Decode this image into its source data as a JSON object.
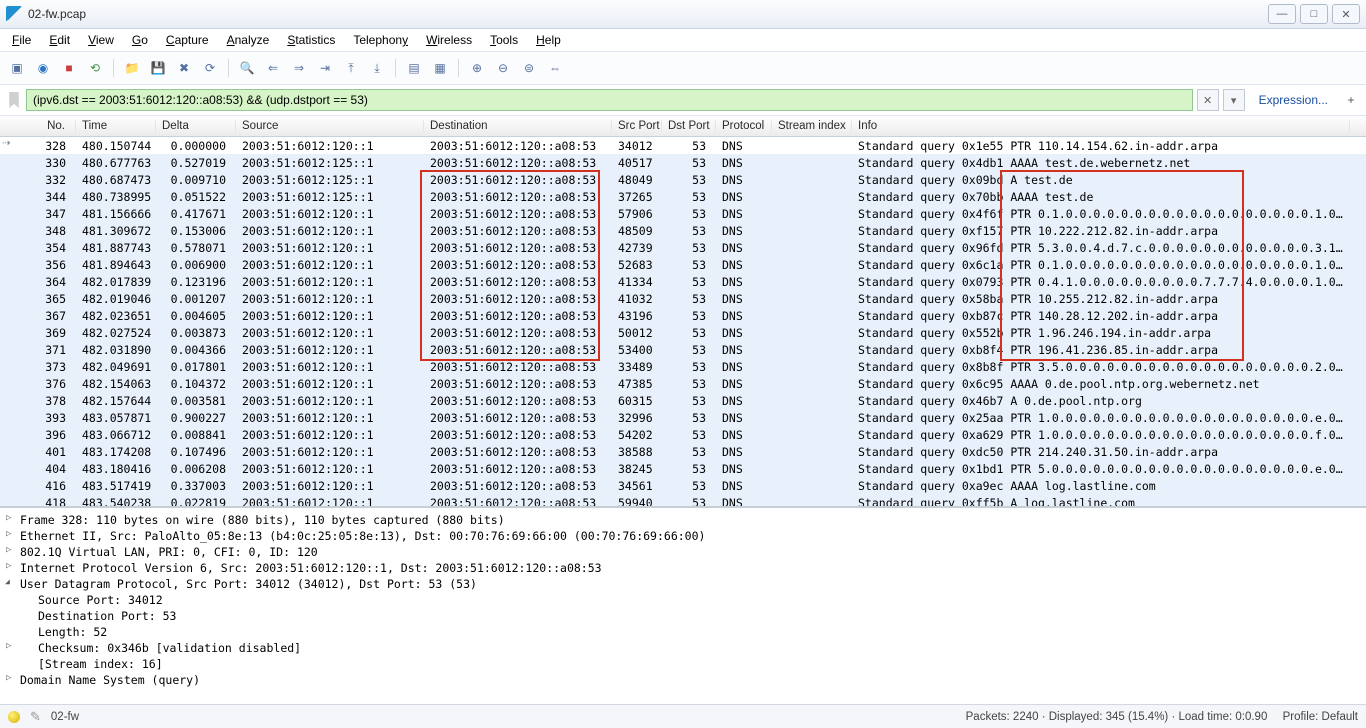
{
  "window": {
    "title": "02-fw.pcap"
  },
  "menu": [
    "File",
    "Edit",
    "View",
    "Go",
    "Capture",
    "Analyze",
    "Statistics",
    "Telephony",
    "Wireless",
    "Tools",
    "Help"
  ],
  "filter": {
    "value": "(ipv6.dst == 2003:51:6012:120::a08:53) && (udp.dstport == 53)",
    "expression_label": "Expression..."
  },
  "columns": {
    "no": "No.",
    "time": "Time",
    "delta": "Delta",
    "source": "Source",
    "destination": "Destination",
    "srcport": "Src Port",
    "dstport": "Dst Port",
    "protocol": "Protocol",
    "stream": "Stream index",
    "info": "Info"
  },
  "rows": [
    {
      "no": "328",
      "time": "480.150744",
      "delta": "0.000000",
      "src": "2003:51:6012:120::1",
      "dst": "2003:51:6012:120::a08:53",
      "sp": "34012",
      "dp": "53",
      "proto": "DNS",
      "info": "Standard query 0x1e55 PTR 110.14.154.62.in-addr.arpa",
      "sel": true
    },
    {
      "no": "330",
      "time": "480.677763",
      "delta": "0.527019",
      "src": "2003:51:6012:125::1",
      "dst": "2003:51:6012:120::a08:53",
      "sp": "40517",
      "dp": "53",
      "proto": "DNS",
      "info": "Standard query 0x4db1 AAAA test.de.webernetz.net"
    },
    {
      "no": "332",
      "time": "480.687473",
      "delta": "0.009710",
      "src": "2003:51:6012:125::1",
      "dst": "2003:51:6012:120::a08:53",
      "sp": "48049",
      "dp": "53",
      "proto": "DNS",
      "info": "Standard query 0x09bd A test.de"
    },
    {
      "no": "344",
      "time": "480.738995",
      "delta": "0.051522",
      "src": "2003:51:6012:125::1",
      "dst": "2003:51:6012:120::a08:53",
      "sp": "37265",
      "dp": "53",
      "proto": "DNS",
      "info": "Standard query 0x70bb AAAA test.de"
    },
    {
      "no": "347",
      "time": "481.156666",
      "delta": "0.417671",
      "src": "2003:51:6012:120::1",
      "dst": "2003:51:6012:120::a08:53",
      "sp": "57906",
      "dp": "53",
      "proto": "DNS",
      "info": "Standard query 0x4f6f PTR 0.1.0.0.0.0.0.0.0.0.0.0.0.0.0.0.0.0.0.0.1.0…"
    },
    {
      "no": "348",
      "time": "481.309672",
      "delta": "0.153006",
      "src": "2003:51:6012:120::1",
      "dst": "2003:51:6012:120::a08:53",
      "sp": "48509",
      "dp": "53",
      "proto": "DNS",
      "info": "Standard query 0xf157 PTR 10.222.212.82.in-addr.arpa"
    },
    {
      "no": "354",
      "time": "481.887743",
      "delta": "0.578071",
      "src": "2003:51:6012:120::1",
      "dst": "2003:51:6012:120::a08:53",
      "sp": "42739",
      "dp": "53",
      "proto": "DNS",
      "info": "Standard query 0x96fd PTR 5.3.0.0.4.d.7.c.0.0.0.0.0.0.0.0.0.0.0.0.3.1…"
    },
    {
      "no": "356",
      "time": "481.894643",
      "delta": "0.006900",
      "src": "2003:51:6012:120::1",
      "dst": "2003:51:6012:120::a08:53",
      "sp": "52683",
      "dp": "53",
      "proto": "DNS",
      "info": "Standard query 0x6c1a PTR 0.1.0.0.0.0.0.0.0.0.0.0.0.0.0.0.0.0.0.0.1.0…"
    },
    {
      "no": "364",
      "time": "482.017839",
      "delta": "0.123196",
      "src": "2003:51:6012:120::1",
      "dst": "2003:51:6012:120::a08:53",
      "sp": "41334",
      "dp": "53",
      "proto": "DNS",
      "info": "Standard query 0x0793 PTR 0.4.1.0.0.0.0.0.0.0.0.0.7.7.7.4.0.0.0.0.1.0…"
    },
    {
      "no": "365",
      "time": "482.019046",
      "delta": "0.001207",
      "src": "2003:51:6012:120::1",
      "dst": "2003:51:6012:120::a08:53",
      "sp": "41032",
      "dp": "53",
      "proto": "DNS",
      "info": "Standard query 0x58ba PTR 10.255.212.82.in-addr.arpa"
    },
    {
      "no": "367",
      "time": "482.023651",
      "delta": "0.004605",
      "src": "2003:51:6012:120::1",
      "dst": "2003:51:6012:120::a08:53",
      "sp": "43196",
      "dp": "53",
      "proto": "DNS",
      "info": "Standard query 0xb87c PTR 140.28.12.202.in-addr.arpa"
    },
    {
      "no": "369",
      "time": "482.027524",
      "delta": "0.003873",
      "src": "2003:51:6012:120::1",
      "dst": "2003:51:6012:120::a08:53",
      "sp": "50012",
      "dp": "53",
      "proto": "DNS",
      "info": "Standard query 0x552b PTR 1.96.246.194.in-addr.arpa"
    },
    {
      "no": "371",
      "time": "482.031890",
      "delta": "0.004366",
      "src": "2003:51:6012:120::1",
      "dst": "2003:51:6012:120::a08:53",
      "sp": "53400",
      "dp": "53",
      "proto": "DNS",
      "info": "Standard query 0xb8f4 PTR 196.41.236.85.in-addr.arpa"
    },
    {
      "no": "373",
      "time": "482.049691",
      "delta": "0.017801",
      "src": "2003:51:6012:120::1",
      "dst": "2003:51:6012:120::a08:53",
      "sp": "33489",
      "dp": "53",
      "proto": "DNS",
      "info": "Standard query 0x8b8f PTR 3.5.0.0.0.0.0.0.0.0.0.0.0.0.0.0.0.0.0.0.2.0…"
    },
    {
      "no": "376",
      "time": "482.154063",
      "delta": "0.104372",
      "src": "2003:51:6012:120::1",
      "dst": "2003:51:6012:120::a08:53",
      "sp": "47385",
      "dp": "53",
      "proto": "DNS",
      "info": "Standard query 0x6c95 AAAA 0.de.pool.ntp.org.webernetz.net"
    },
    {
      "no": "378",
      "time": "482.157644",
      "delta": "0.003581",
      "src": "2003:51:6012:120::1",
      "dst": "2003:51:6012:120::a08:53",
      "sp": "60315",
      "dp": "53",
      "proto": "DNS",
      "info": "Standard query 0x46b7 A 0.de.pool.ntp.org"
    },
    {
      "no": "393",
      "time": "483.057871",
      "delta": "0.900227",
      "src": "2003:51:6012:120::1",
      "dst": "2003:51:6012:120::a08:53",
      "sp": "32996",
      "dp": "53",
      "proto": "DNS",
      "info": "Standard query 0x25aa PTR 1.0.0.0.0.0.0.0.0.0.0.0.0.0.0.0.0.0.0.0.e.0…"
    },
    {
      "no": "396",
      "time": "483.066712",
      "delta": "0.008841",
      "src": "2003:51:6012:120::1",
      "dst": "2003:51:6012:120::a08:53",
      "sp": "54202",
      "dp": "53",
      "proto": "DNS",
      "info": "Standard query 0xa629 PTR 1.0.0.0.0.0.0.0.0.0.0.0.0.0.0.0.0.0.0.0.f.0…"
    },
    {
      "no": "401",
      "time": "483.174208",
      "delta": "0.107496",
      "src": "2003:51:6012:120::1",
      "dst": "2003:51:6012:120::a08:53",
      "sp": "38588",
      "dp": "53",
      "proto": "DNS",
      "info": "Standard query 0xdc50 PTR 214.240.31.50.in-addr.arpa"
    },
    {
      "no": "404",
      "time": "483.180416",
      "delta": "0.006208",
      "src": "2003:51:6012:120::1",
      "dst": "2003:51:6012:120::a08:53",
      "sp": "38245",
      "dp": "53",
      "proto": "DNS",
      "info": "Standard query 0x1bd1 PTR 5.0.0.0.0.0.0.0.0.0.0.0.0.0.0.0.0.0.0.0.e.0…"
    },
    {
      "no": "416",
      "time": "483.517419",
      "delta": "0.337003",
      "src": "2003:51:6012:120::1",
      "dst": "2003:51:6012:120::a08:53",
      "sp": "34561",
      "dp": "53",
      "proto": "DNS",
      "info": "Standard query 0xa9ec AAAA log.lastline.com"
    },
    {
      "no": "418",
      "time": "483.540238",
      "delta": "0.022819",
      "src": "2003:51:6012:120::1",
      "dst": "2003:51:6012:120::a08:53",
      "sp": "59940",
      "dp": "53",
      "proto": "DNS",
      "info": "Standard query 0xff5b A log.lastline.com"
    }
  ],
  "details": {
    "frame": "Frame 328: 110 bytes on wire (880 bits), 110 bytes captured (880 bits)",
    "eth": "Ethernet II, Src: PaloAlto_05:8e:13 (b4:0c:25:05:8e:13), Dst: 00:70:76:69:66:00 (00:70:76:69:66:00)",
    "vlan": "802.1Q Virtual LAN, PRI: 0, CFI: 0, ID: 120",
    "ip6": "Internet Protocol Version 6, Src: 2003:51:6012:120::1, Dst: 2003:51:6012:120::a08:53",
    "udp": "User Datagram Protocol, Src Port: 34012 (34012), Dst Port: 53 (53)",
    "udp_src": "Source Port: 34012",
    "udp_dst": "Destination Port: 53",
    "udp_len": "Length: 52",
    "udp_chk": "Checksum: 0x346b [validation disabled]",
    "udp_sidx": "[Stream index: 16]",
    "dns": "Domain Name System (query)"
  },
  "status": {
    "file": "02-fw",
    "center": "Packets: 2240 · Displayed: 345 (15.4%) · Load time: 0:0.90",
    "profile": "Profile: Default"
  }
}
